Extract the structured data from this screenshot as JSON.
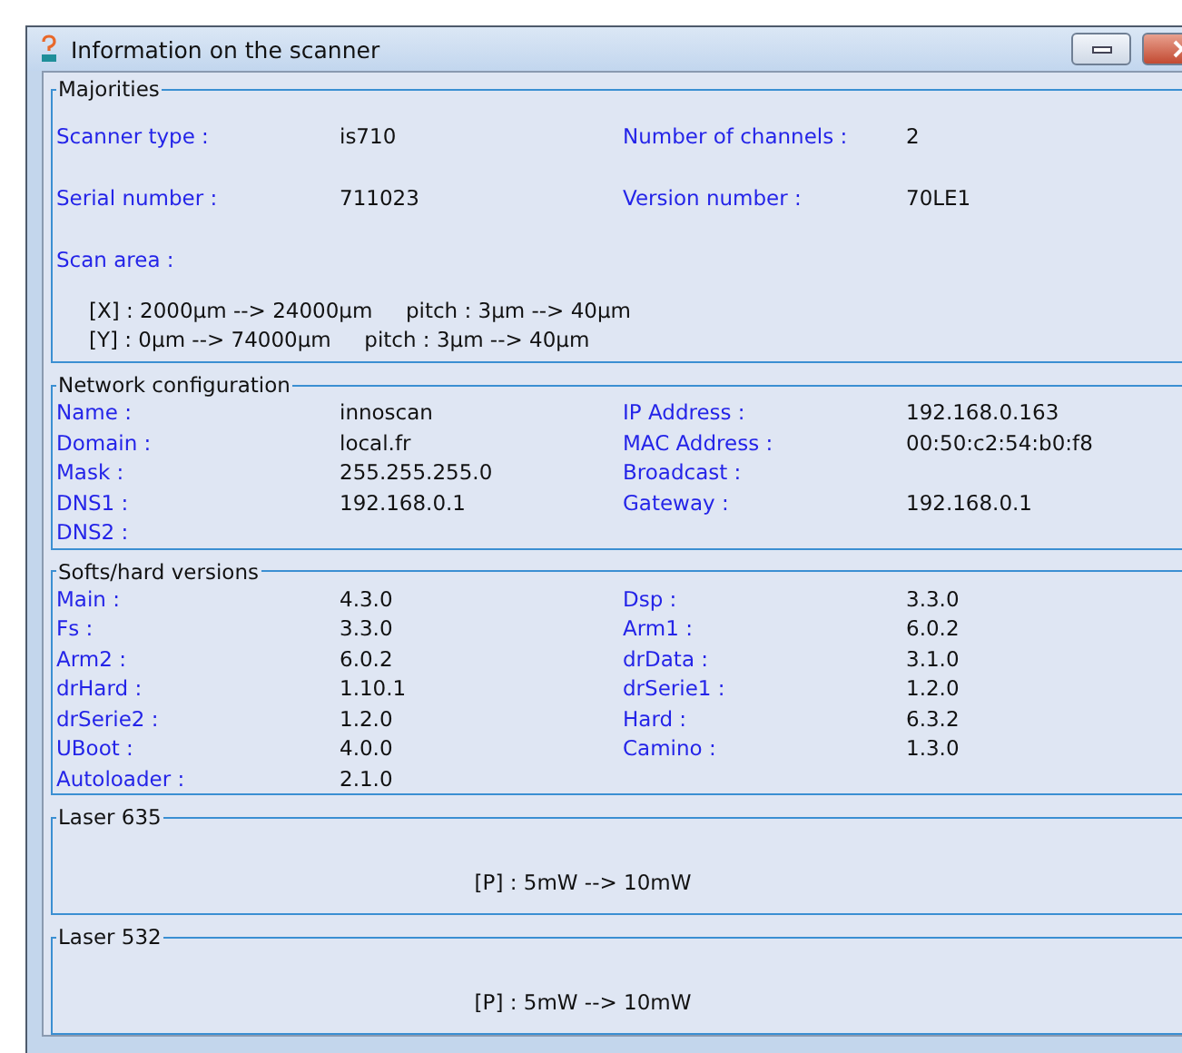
{
  "window": {
    "title": "Information on the scanner"
  },
  "sections": [
    {
      "kind": "spaced",
      "title": "Majorities",
      "rows": [
        {
          "label": "Scanner type :",
          "value": "is710",
          "label2": "Number of channels :",
          "value2": "2"
        },
        {
          "label": "Serial number :",
          "value": "711023",
          "label2": "Version number :",
          "value2": "70LE1"
        }
      ],
      "scan_area": {
        "label": "Scan area :",
        "lines": [
          "[X] : 2000µm --> 24000µm     pitch : 3µm --> 40µm",
          "[Y] : 0µm --> 74000µm     pitch : 3µm --> 40µm"
        ]
      }
    },
    {
      "kind": "dense",
      "title": "Network configuration",
      "rows": [
        {
          "label": "Name :",
          "value": "innoscan",
          "label2": "IP Address :",
          "value2": "192.168.0.163"
        },
        {
          "label": "Domain :",
          "value": "local.fr",
          "label2": "MAC Address :",
          "value2": "00:50:c2:54:b0:f8"
        },
        {
          "label": "Mask :",
          "value": "255.255.255.0",
          "label2": "Broadcast :"
        },
        {
          "label": "DNS1 :",
          "value": "192.168.0.1",
          "label2": "Gateway :",
          "value2": "192.168.0.1"
        },
        {
          "label": "DNS2 :"
        }
      ]
    },
    {
      "kind": "dense",
      "title": "Softs/hard versions",
      "rows": [
        {
          "label": "Main :",
          "value": "4.3.0",
          "label2": "Dsp :",
          "value2": "3.3.0"
        },
        {
          "label": "Fs :",
          "value": "3.3.0",
          "label2": "Arm1 :",
          "value2": "6.0.2"
        },
        {
          "label": "Arm2 :",
          "value": "6.0.2",
          "label2": "drData :",
          "value2": "3.1.0"
        },
        {
          "label": "drHard :",
          "value": "1.10.1",
          "label2": "drSerie1 :",
          "value2": "1.2.0"
        },
        {
          "label": "drSerie2 :",
          "value": "1.2.0",
          "label2": "Hard :",
          "value2": "6.3.2"
        },
        {
          "label": "UBoot :",
          "value": "4.0.0",
          "label2": "Camino :",
          "value2": "1.3.0"
        },
        {
          "label": "Autoloader :",
          "value": "2.1.0"
        }
      ]
    },
    {
      "kind": "center",
      "title": "Laser 635",
      "text": "[P] : 5mW --> 10mW"
    },
    {
      "kind": "center",
      "title": "Laser 532",
      "text": "[P] : 5mW --> 10mW"
    }
  ]
}
